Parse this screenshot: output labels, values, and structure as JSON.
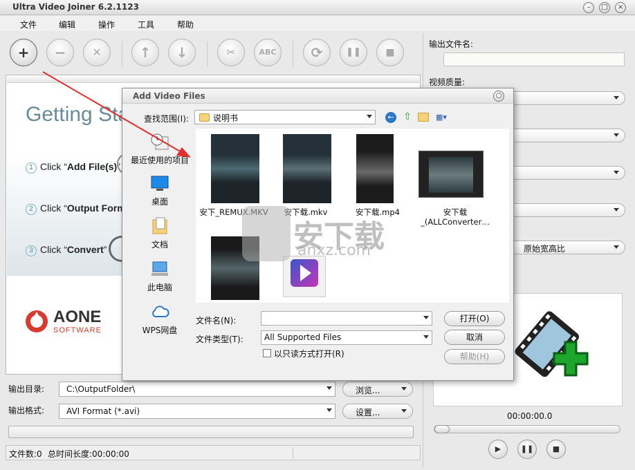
{
  "app": {
    "title": "Ultra Video Joiner 6.2.1123"
  },
  "menu": [
    "文件",
    "编辑",
    "操作",
    "工具",
    "帮助"
  ],
  "toolbar": {
    "buttons": [
      {
        "name": "add-file-button",
        "glyph": "+"
      },
      {
        "name": "remove-file-button",
        "glyph": "−"
      },
      {
        "name": "clear-list-button",
        "glyph": "✕"
      },
      {
        "name": "move-up-button",
        "glyph": "↑"
      },
      {
        "name": "move-down-button",
        "glyph": "↓"
      },
      {
        "name": "cut-button",
        "glyph": "✂"
      },
      {
        "name": "rename-button",
        "glyph": "ABC"
      },
      {
        "name": "convert-button",
        "glyph": "⟳"
      },
      {
        "name": "pause-button",
        "glyph": "❚❚"
      },
      {
        "name": "stop-button",
        "glyph": "■"
      }
    ]
  },
  "getting_started": {
    "title": "Getting Sta",
    "steps": [
      {
        "num": "1",
        "prefix": "Click “",
        "bold": "Add File(s)",
        "suffix": "”"
      },
      {
        "num": "2",
        "prefix": "Click “",
        "bold": "Output Forma",
        "suffix": ""
      },
      {
        "num": "3",
        "prefix": "Click “",
        "bold": "Convert",
        "suffix": "”"
      }
    ]
  },
  "logo": {
    "name": "AONE",
    "sub": "SOFTWARE"
  },
  "output": {
    "dir_label": "输出目录:",
    "dir_value": "C:\\OutputFolder\\",
    "browse_label": "浏览...",
    "format_label": "输出格式:",
    "format_value": "AVI Format (*.avi)",
    "settings_label": "设置..."
  },
  "status": {
    "file_count": "文件数:0",
    "total_duration": "总时间长度:00:00:00"
  },
  "right_panel": {
    "output_filename_label": "输出文件名:",
    "output_filename_value": "",
    "video_quality_label": "视频质量:",
    "aspect_value": "原始宽高比",
    "timecode": "00:00:00.0",
    "player": {
      "play": "▶",
      "pause": "❚❚",
      "stop": "■"
    }
  },
  "dialog": {
    "title": "Add Video Files",
    "lookin_label": "查找范围(I):",
    "lookin_value": "说明书",
    "places": [
      "最近使用的项目",
      "桌面",
      "文档",
      "此电脑",
      "WPS网盘"
    ],
    "files": [
      {
        "name": "安下_REMUX.MKV",
        "kind": "video"
      },
      {
        "name": "安下载.mkv",
        "kind": "video"
      },
      {
        "name": "安下载.mp4",
        "kind": "video"
      },
      {
        "name": "安下载_(ALLConverter…",
        "kind": "film"
      },
      {
        "name": "",
        "kind": "video"
      },
      {
        "name": "",
        "kind": "app"
      }
    ],
    "filename_label": "文件名(N):",
    "filename_value": "",
    "filetype_label": "文件类型(T):",
    "filetype_value": "All Supported Files",
    "readonly_label": "以只读方式打开(R)",
    "open_label": "打开(O)",
    "cancel_label": "取消",
    "help_label": "帮助(H)"
  },
  "watermark": {
    "text": "安下载",
    "url": "anxz.com"
  },
  "colors": {
    "accent_red": "#e2312d",
    "plus_green": "#1ea62c",
    "logo_red": "#d73a2f"
  }
}
